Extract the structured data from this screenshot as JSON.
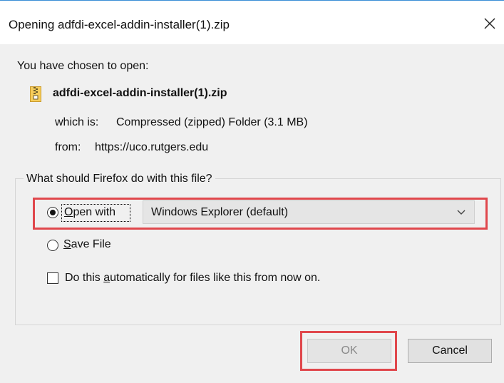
{
  "window": {
    "title": "Opening adfdi-excel-addin-installer(1).zip",
    "close_icon": "close-icon"
  },
  "info": {
    "intro": "You have chosen to open:",
    "file_icon": "zip-file-icon",
    "filename": "adfdi-excel-addin-installer(1).zip",
    "which_is_label": "which is:",
    "which_is_value": "Compressed (zipped) Folder (3.1 MB)",
    "from_label": "from:",
    "from_value": "https://uco.rutgers.edu"
  },
  "action_group": {
    "legend": "What should Firefox do with this file?",
    "open_with": {
      "label_access_key": "O",
      "label_rest": "pen with",
      "selected": true
    },
    "application_select": {
      "value": "Windows Explorer (default)"
    },
    "save_file": {
      "label_access_key": "S",
      "label_rest": "ave File",
      "selected": false
    },
    "auto_checkbox": {
      "label_before": "Do this ",
      "label_access_key": "a",
      "label_after": "utomatically for files like this from now on.",
      "checked": false
    }
  },
  "buttons": {
    "ok": {
      "label": "OK",
      "disabled": true
    },
    "cancel": {
      "label": "Cancel"
    }
  },
  "annotation_color": "#e0474c"
}
